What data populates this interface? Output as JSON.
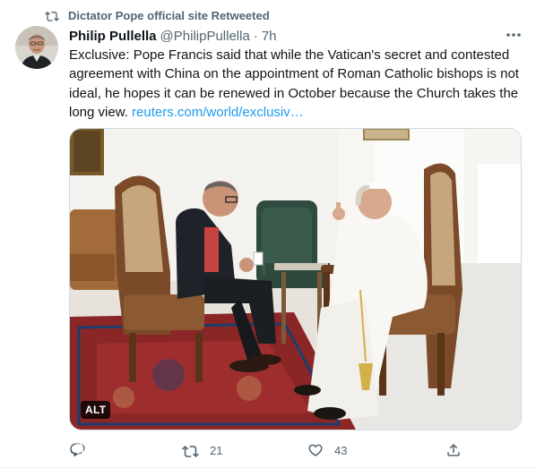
{
  "retweet": {
    "label": "Dictator Pope official site Retweeted",
    "icon": "retweet-icon"
  },
  "author": {
    "name": "Philip Pullella",
    "handle": "@PhilipPullella",
    "separator": "·",
    "time": "7h"
  },
  "tweet": {
    "text": "Exclusive: Pope Francis said that while the Vatican's secret and contested agreement with China on the appointment of Roman Catholic bishops is not ideal, he hopes it can be renewed in October because the Church takes the long view.",
    "link": "reuters.com/world/exclusiv…"
  },
  "media": {
    "alt_badge": "ALT"
  },
  "actions": {
    "reply_count": "",
    "retweet_count": "21",
    "like_count": "43"
  },
  "colors": {
    "text": "#0f1419",
    "secondary": "#536471",
    "link": "#1d9bf0",
    "border": "#cfd9de"
  }
}
